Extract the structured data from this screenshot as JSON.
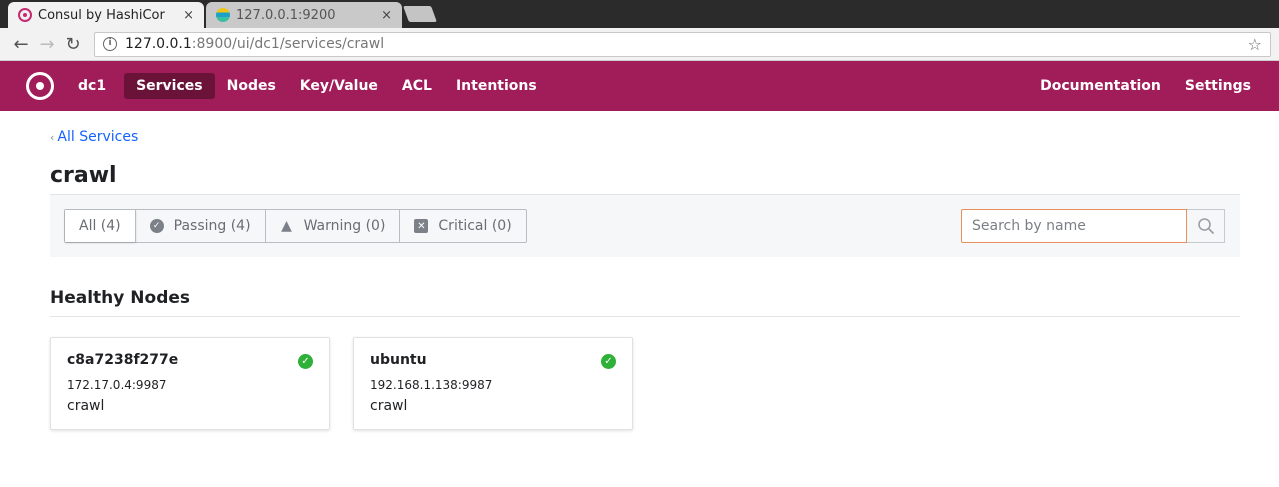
{
  "browser": {
    "tabs": [
      {
        "title": "Consul by HashiCor",
        "close": "×"
      },
      {
        "title": "127.0.0.1:9200",
        "close": "×"
      }
    ],
    "url_host": "127.0.0.1",
    "url_path": ":8900/ui/dc1/services/crawl"
  },
  "nav": {
    "datacenter": "dc1",
    "items": [
      "Services",
      "Nodes",
      "Key/Value",
      "ACL",
      "Intentions"
    ],
    "right": [
      "Documentation",
      "Settings"
    ]
  },
  "page": {
    "back_link": "All Services",
    "title": "crawl"
  },
  "filters": [
    {
      "label": "All (4)"
    },
    {
      "label": "Passing (4)"
    },
    {
      "label": "Warning (0)"
    },
    {
      "label": "Critical (0)"
    }
  ],
  "search": {
    "placeholder": "Search by name",
    "value": ""
  },
  "healthy_nodes": {
    "title": "Healthy Nodes",
    "nodes": [
      {
        "name": "c8a7238f277e",
        "address": "172.17.0.4:9987",
        "service": "crawl"
      },
      {
        "name": "ubuntu",
        "address": "192.168.1.138:9987",
        "service": "crawl"
      }
    ]
  },
  "colors": {
    "brand": "#a11d5a",
    "brand_active": "#6b1239",
    "link": "#1563ff",
    "passing": "#2eb039",
    "search_focus": "#e8905c"
  }
}
